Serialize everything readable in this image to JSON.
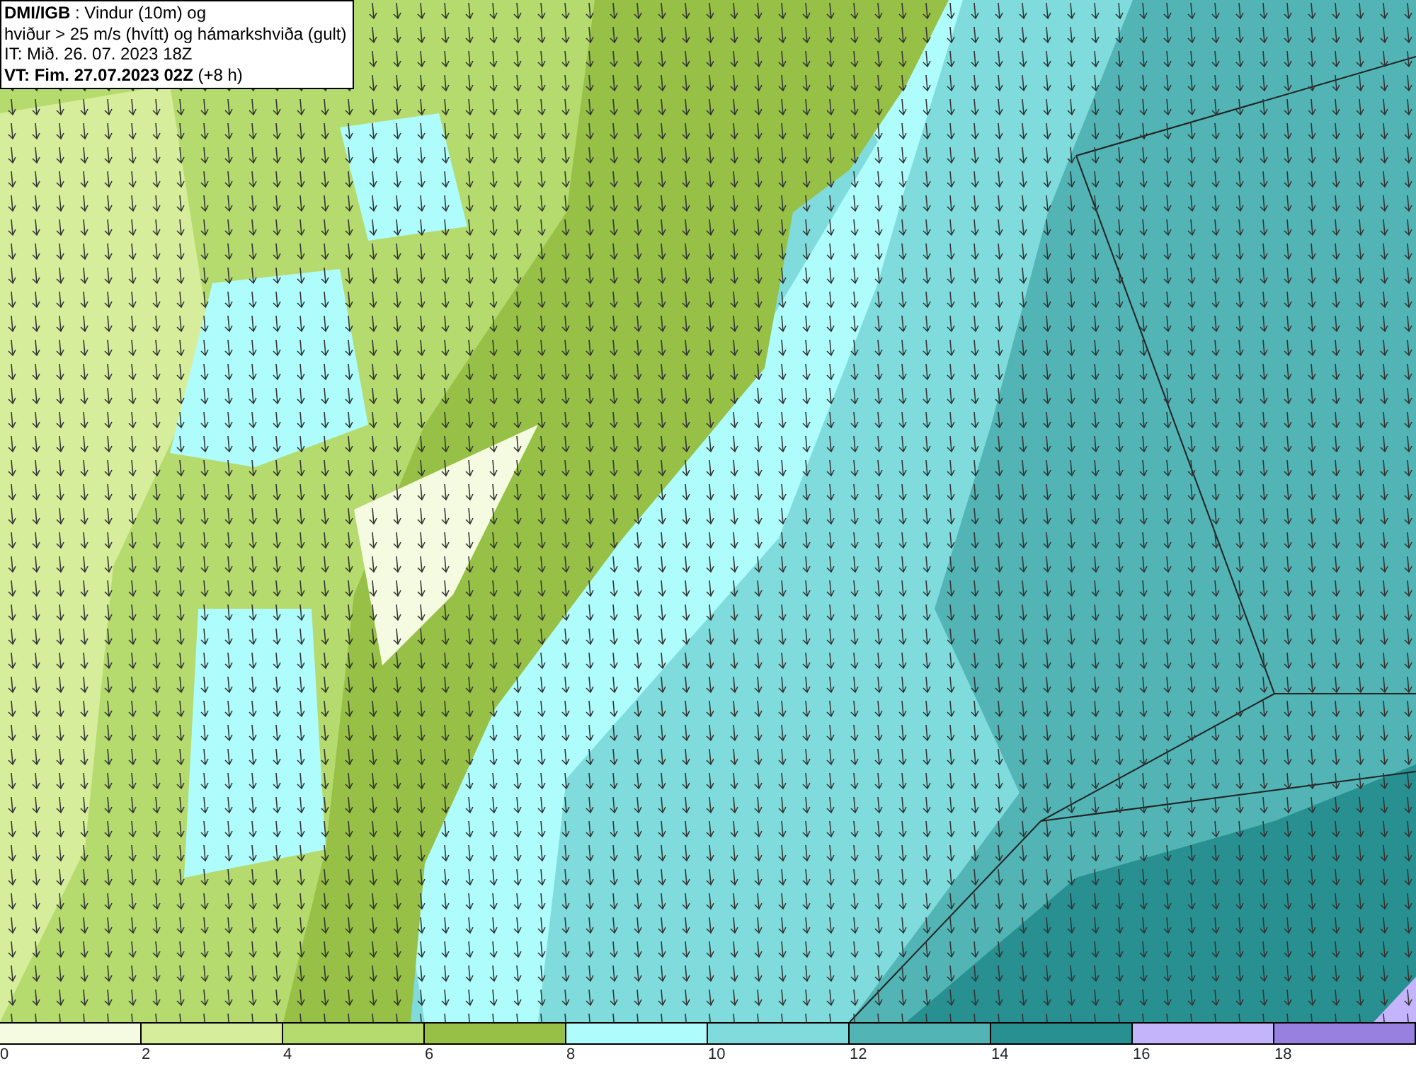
{
  "header": {
    "lines": [
      "**DMI/IGB** : Vindur (10m) og",
      "hviður > 25 m/s (hvítt) og hámarkshviða (gult)",
      "IT: Mið. 26. 07. 2023 18Z",
      "**VT: Fim. 27.07.2023 02Z** (+8 h)"
    ]
  },
  "legend": {
    "swatches": [
      {
        "color": "#f5fbe0"
      },
      {
        "color": "#d6ee9c"
      },
      {
        "color": "#b5da6e"
      },
      {
        "color": "#97c046"
      },
      {
        "color": "#aefcfc"
      },
      {
        "color": "#80dcdc"
      },
      {
        "color": "#52b4b4"
      },
      {
        "color": "#289090"
      },
      {
        "color": "#c4b4fc"
      },
      {
        "color": "#9880e0"
      }
    ],
    "ticks": [
      "0",
      "2",
      "4",
      "6",
      "8",
      "10",
      "12",
      "14",
      "16",
      "18"
    ]
  }
}
